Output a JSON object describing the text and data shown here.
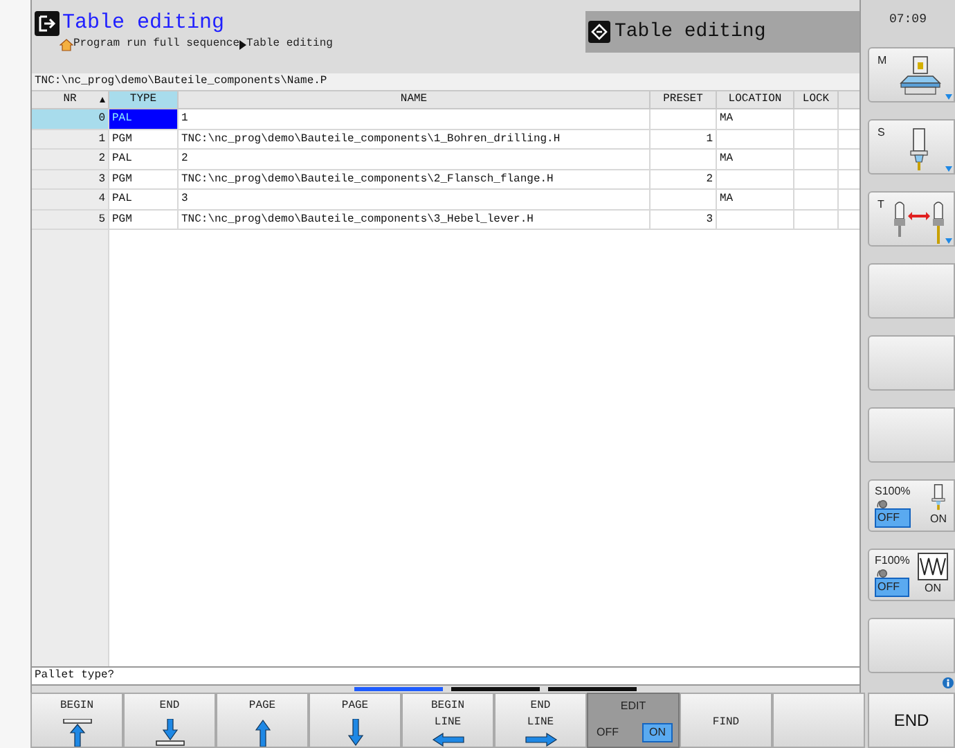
{
  "header": {
    "title": "Table editing",
    "breadcrumb": [
      "Program run full sequence",
      "Table editing"
    ],
    "mode_title": "Table editing"
  },
  "clock": "07:09",
  "path": "TNC:\\nc_prog\\demo\\Bauteile_components\\Name.P",
  "table": {
    "columns": [
      {
        "label": "NR",
        "selected": false
      },
      {
        "label": "TYPE",
        "selected": true
      },
      {
        "label": "NAME",
        "selected": false
      },
      {
        "label": "PRESET",
        "selected": false
      },
      {
        "label": "LOCATION",
        "selected": false
      },
      {
        "label": "LOCK",
        "selected": false
      }
    ],
    "rows": [
      {
        "selected": true,
        "cells": [
          "0",
          "PAL",
          "1",
          "",
          "MA",
          ""
        ]
      },
      {
        "selected": false,
        "cells": [
          "1",
          "PGM",
          "TNC:\\nc_prog\\demo\\Bauteile_components\\1_Bohren_drilling.H",
          "1",
          "",
          ""
        ]
      },
      {
        "selected": false,
        "cells": [
          "2",
          "PAL",
          "2",
          "",
          "MA",
          ""
        ]
      },
      {
        "selected": false,
        "cells": [
          "3",
          "PGM",
          "TNC:\\nc_prog\\demo\\Bauteile_components\\2_Flansch_flange.H",
          "2",
          "",
          ""
        ]
      },
      {
        "selected": false,
        "cells": [
          "4",
          "PAL",
          "3",
          "",
          "MA",
          ""
        ]
      },
      {
        "selected": false,
        "cells": [
          "5",
          "PGM",
          "TNC:\\nc_prog\\demo\\Bauteile_components\\3_Hebel_lever.H",
          "3",
          "",
          ""
        ]
      }
    ]
  },
  "status_line": "Pallet type?",
  "softkey_pages": [
    {
      "selected": true
    },
    {
      "selected": false
    },
    {
      "selected": false
    }
  ],
  "side_keys": [
    {
      "kind": "machine",
      "label": "M"
    },
    {
      "kind": "spindle",
      "label": "S"
    },
    {
      "kind": "tool",
      "label": "T"
    },
    {
      "kind": "empty"
    },
    {
      "kind": "empty"
    },
    {
      "kind": "empty"
    },
    {
      "kind": "spindle_override",
      "label": "S100%",
      "off": "OFF",
      "on_label": "ON",
      "on": false
    },
    {
      "kind": "feed_override",
      "label": "F100%",
      "off": "OFF",
      "on_label": "ON",
      "on": false
    },
    {
      "kind": "empty"
    }
  ],
  "softkeys": [
    {
      "kind": "begin",
      "lines": [
        "BEGIN"
      ]
    },
    {
      "kind": "end",
      "lines": [
        "END"
      ]
    },
    {
      "kind": "up",
      "lines": [
        "PAGE"
      ]
    },
    {
      "kind": "down",
      "lines": [
        "PAGE"
      ]
    },
    {
      "kind": "left",
      "lines": [
        "BEGIN",
        "LINE"
      ]
    },
    {
      "kind": "right",
      "lines": [
        "END",
        "LINE"
      ]
    },
    {
      "kind": "toggle",
      "lines": [
        "EDIT"
      ],
      "off": "OFF",
      "on_label": "ON",
      "on": true
    },
    {
      "kind": "text",
      "lines": [
        "FIND"
      ]
    },
    {
      "kind": "empty"
    }
  ],
  "end_key": "END"
}
